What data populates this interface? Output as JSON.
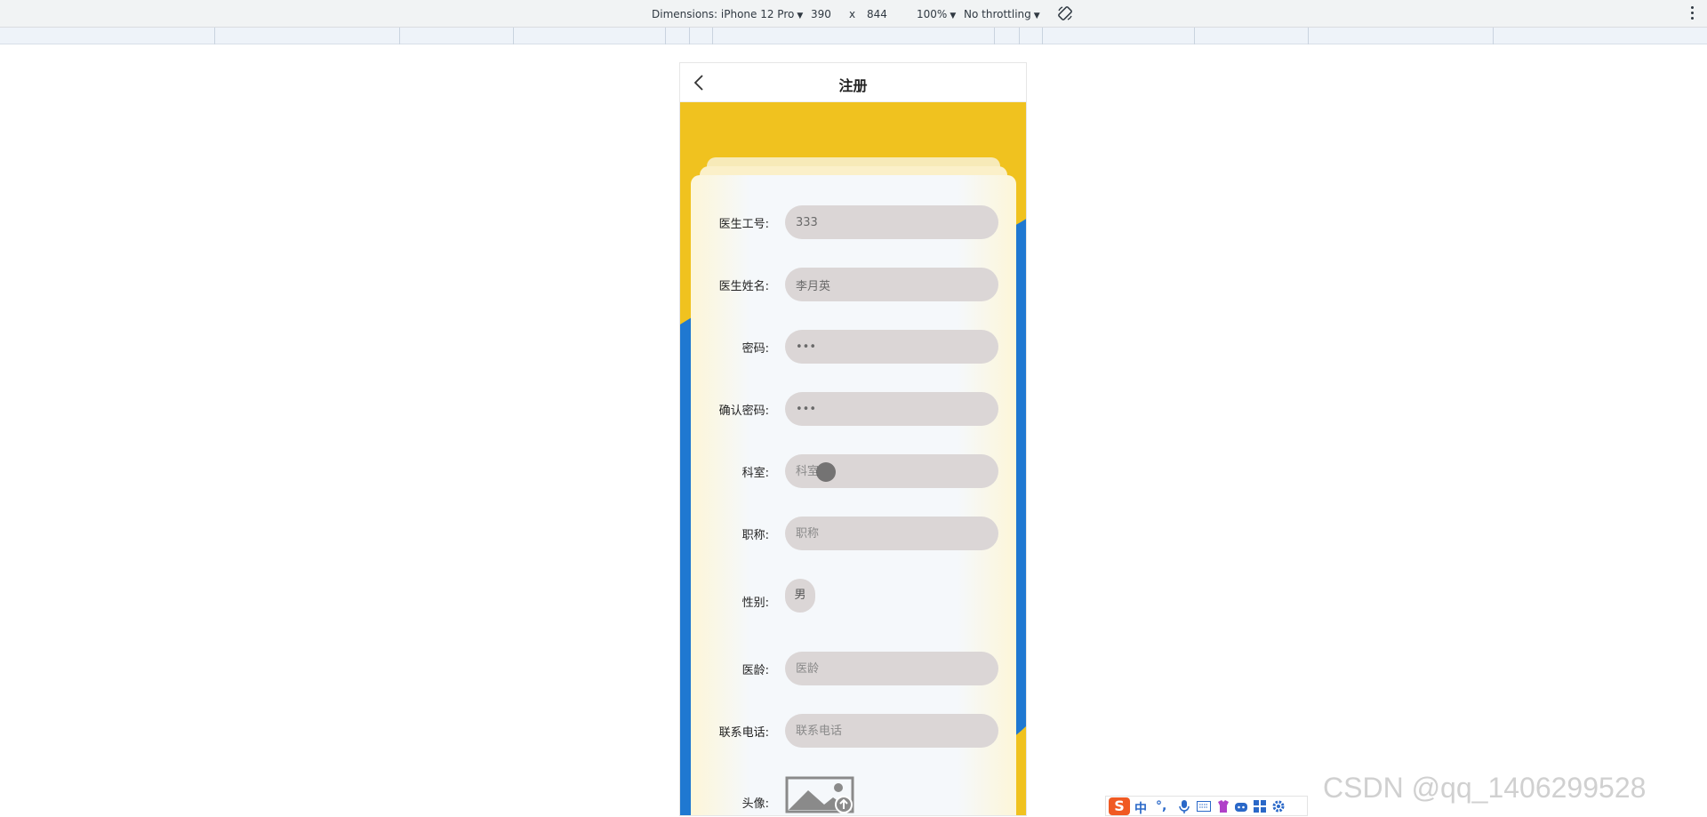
{
  "devtools": {
    "dimensions_label": "Dimensions: iPhone 12 Pro",
    "width": "390",
    "times": "x",
    "height": "844",
    "zoom": "100%",
    "throttling": "No throttling"
  },
  "page": {
    "title": "注册",
    "fields": [
      {
        "label": "医生工号:",
        "value": "333",
        "placeholder": ""
      },
      {
        "label": "医生姓名:",
        "value": "李月英",
        "placeholder": ""
      },
      {
        "label": "密码:",
        "value": "•••",
        "placeholder": ""
      },
      {
        "label": "确认密码:",
        "value": "•••",
        "placeholder": ""
      },
      {
        "label": "科室:",
        "value": "",
        "placeholder": "科室"
      },
      {
        "label": "职称:",
        "value": "",
        "placeholder": "职称"
      }
    ],
    "gender": {
      "label": "性别:",
      "value": "男"
    },
    "fields2": [
      {
        "label": "医龄:",
        "value": "",
        "placeholder": "医龄"
      },
      {
        "label": "联系电话:",
        "value": "",
        "placeholder": "联系电话"
      }
    ],
    "avatar": {
      "label": "头像:"
    }
  },
  "ime": {
    "logo": "S",
    "mode": "中",
    "punct": "°,"
  },
  "watermark": "CSDN @qq_1406299528",
  "colors": {
    "yellow": "#f0c21f",
    "blue": "#1f78d1",
    "input_bg": "#dbd6d6"
  }
}
